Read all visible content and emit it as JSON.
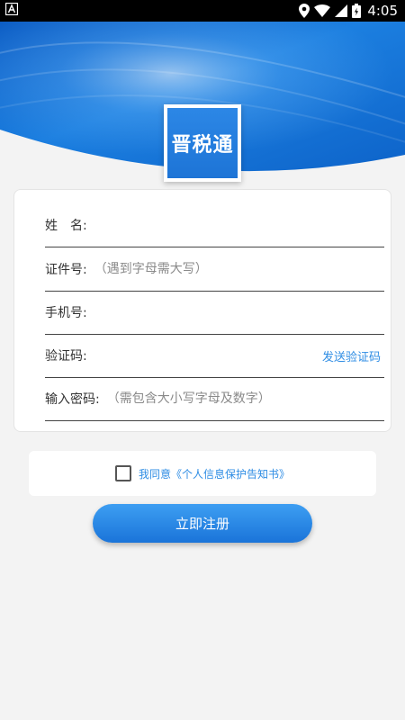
{
  "status_bar": {
    "time": "4:05",
    "icons": [
      "app-notification-icon",
      "location-icon",
      "wifi-icon",
      "signal-icon",
      "battery-icon"
    ]
  },
  "logo": {
    "text": "晋税通"
  },
  "form": {
    "name": {
      "label": "姓　名:",
      "placeholder": ""
    },
    "id_number": {
      "label": "证件号:",
      "placeholder": "（遇到字母需大写）"
    },
    "phone": {
      "label": "手机号:",
      "placeholder": ""
    },
    "verify_code": {
      "label": "验证码:",
      "placeholder": "",
      "send_label": "发送验证码"
    },
    "password": {
      "label": "输入密码:",
      "placeholder": "（需包含大小写字母及数字）"
    }
  },
  "agreement": {
    "text": "我同意《个人信息保护告知书》",
    "checked": false
  },
  "register_button": {
    "label": "立即注册"
  },
  "colors": {
    "accent": "#2f8de4",
    "header_blue": "#1d74d6",
    "background": "#f3f3f3",
    "status_bar": "#000000"
  }
}
